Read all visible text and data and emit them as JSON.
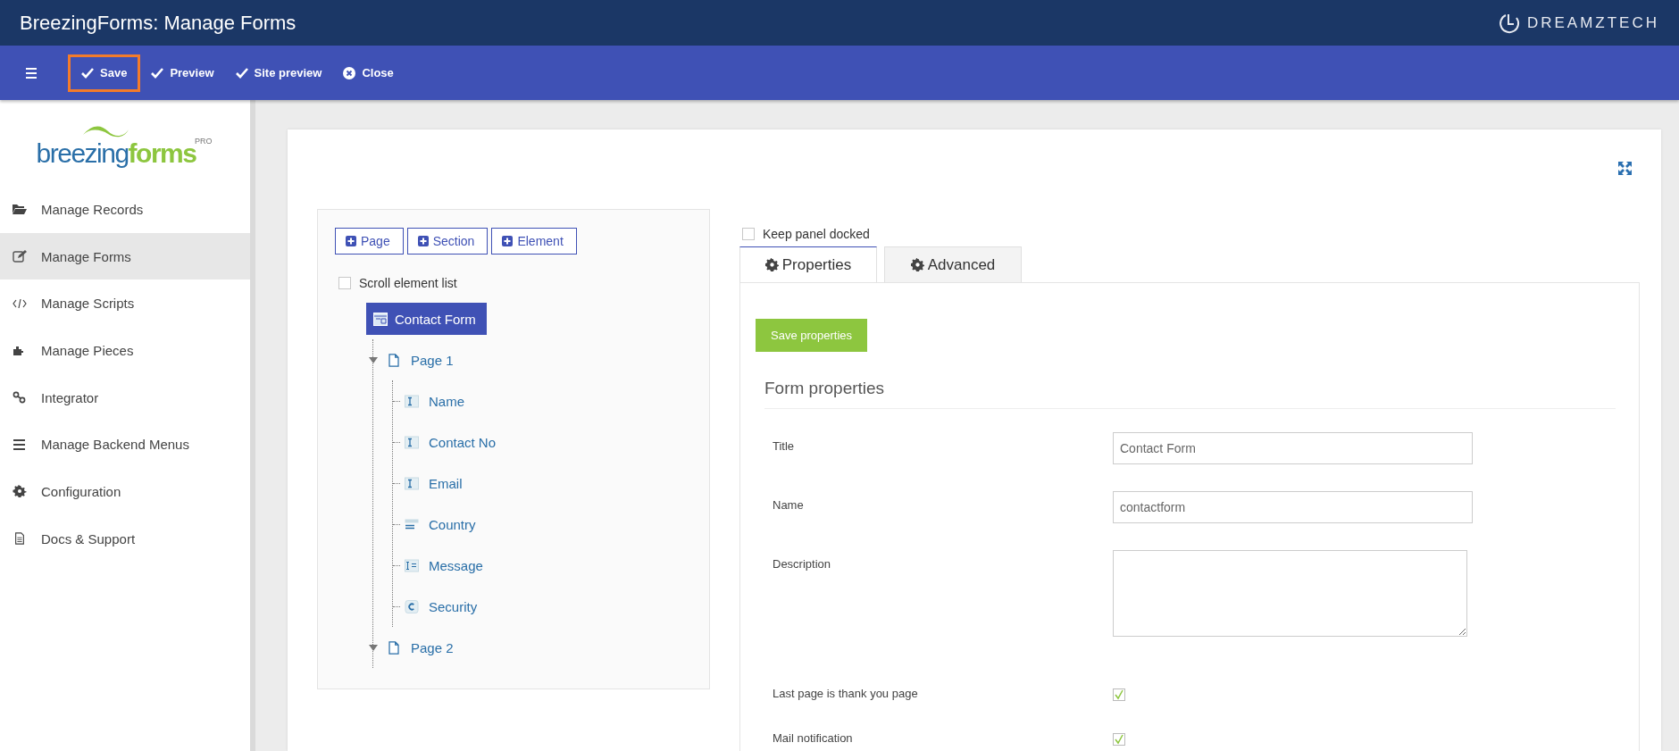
{
  "window": {
    "title": "BreezingForms: Manage Forms",
    "brand": "DREAMZTECH"
  },
  "toolbar": {
    "items": [
      {
        "label": "Save",
        "highlighted": true
      },
      {
        "label": "Preview",
        "highlighted": false
      },
      {
        "label": "Site preview",
        "highlighted": false
      },
      {
        "label": "Close",
        "highlighted": false
      }
    ]
  },
  "sidebar": {
    "logo": {
      "word_1": "breezing",
      "word_2": "forms",
      "badge": "PRO"
    },
    "items": [
      {
        "label": "Manage Records",
        "selected": false
      },
      {
        "label": "Manage Forms",
        "selected": true
      },
      {
        "label": "Manage Scripts",
        "selected": false
      },
      {
        "label": "Manage Pieces",
        "selected": false
      },
      {
        "label": "Integrator",
        "selected": false
      },
      {
        "label": "Manage Backend Menus",
        "selected": false
      },
      {
        "label": "Configuration",
        "selected": false
      },
      {
        "label": "Docs & Support",
        "selected": false
      }
    ]
  },
  "element_tree": {
    "add_buttons": [
      "Page",
      "Section",
      "Element"
    ],
    "scroll_checkbox": {
      "label": "Scroll element list",
      "checked": false
    },
    "root": {
      "label": "Contact Form",
      "selected": true,
      "children": [
        {
          "label": "Page 1",
          "kind": "page",
          "expanded": true,
          "selected": false,
          "children": [
            {
              "label": "Name",
              "kind": "text",
              "selected": false
            },
            {
              "label": "Contact No",
              "kind": "text",
              "selected": false
            },
            {
              "label": "Email",
              "kind": "text",
              "selected": false
            },
            {
              "label": "Country",
              "kind": "select",
              "selected": false
            },
            {
              "label": "Message",
              "kind": "textarea",
              "selected": false
            },
            {
              "label": "Security",
              "kind": "captcha",
              "selected": false
            }
          ]
        },
        {
          "label": "Page 2",
          "kind": "page",
          "expanded": true,
          "selected": false
        }
      ]
    }
  },
  "properties_panel": {
    "dock_checkbox": {
      "label": "Keep panel docked",
      "checked": false
    },
    "tabs": [
      {
        "label": "Properties",
        "selected": true
      },
      {
        "label": "Advanced",
        "selected": false
      }
    ],
    "save_button": "Save properties",
    "section_title": "Form properties",
    "fields": [
      {
        "label": "Title",
        "kind": "text",
        "value": "Contact Form"
      },
      {
        "label": "Name",
        "kind": "text",
        "value": "contactform"
      },
      {
        "label": "Description",
        "kind": "textarea"
      },
      {
        "label": "Last page is thank you page",
        "kind": "checkbox",
        "checked": true
      },
      {
        "label": "Mail notification",
        "kind": "checkbox",
        "checked": true
      }
    ]
  }
}
